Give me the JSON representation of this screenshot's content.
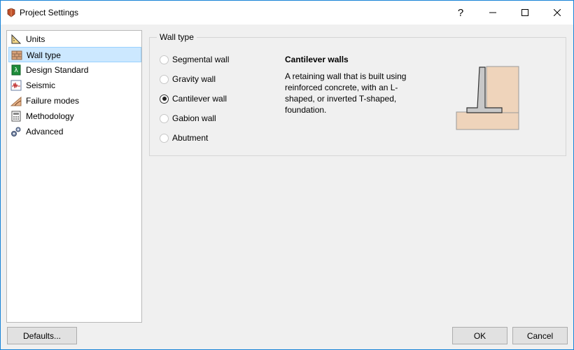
{
  "window": {
    "title": "Project Settings"
  },
  "titlebar": {
    "help": "?"
  },
  "nav": {
    "items": [
      {
        "label": "Units",
        "icon": "units-icon"
      },
      {
        "label": "Wall type",
        "icon": "wall-type-icon",
        "selected": true
      },
      {
        "label": "Design Standard",
        "icon": "design-standard-icon"
      },
      {
        "label": "Seismic",
        "icon": "seismic-icon"
      },
      {
        "label": "Failure modes",
        "icon": "failure-modes-icon"
      },
      {
        "label": "Methodology",
        "icon": "methodology-icon"
      },
      {
        "label": "Advanced",
        "icon": "advanced-icon"
      }
    ]
  },
  "wall_type": {
    "group_title": "Wall type",
    "options": [
      {
        "label": "Segmental wall",
        "checked": false
      },
      {
        "label": "Gravity wall",
        "checked": false
      },
      {
        "label": "Cantilever wall",
        "checked": true
      },
      {
        "label": "Gabion wall",
        "checked": false
      },
      {
        "label": "Abutment",
        "checked": false
      }
    ],
    "description_title": "Cantilever walls",
    "description": "A retaining wall that is built using reinforced concrete, with an L-shaped, or inverted T-shaped, foundation."
  },
  "buttons": {
    "defaults": "Defaults...",
    "ok": "OK",
    "cancel": "Cancel"
  },
  "colors": {
    "selection_bg": "#cce8ff",
    "selection_border": "#99d1ff",
    "soil": "#efd4bb",
    "concrete": "#c8c8c8"
  }
}
